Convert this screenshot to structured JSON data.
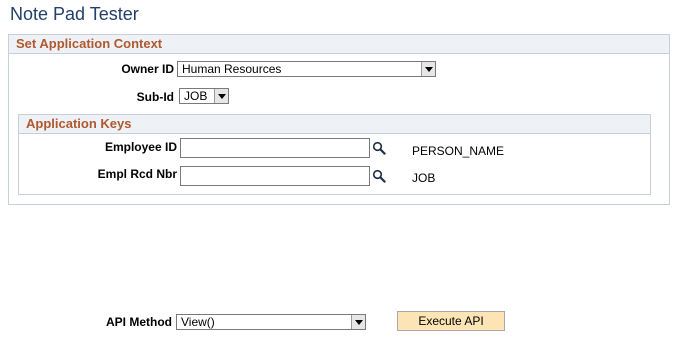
{
  "page": {
    "title": "Note Pad Tester"
  },
  "context": {
    "header": "Set Application Context",
    "owner_id": {
      "label": "Owner ID",
      "value": "Human Resources"
    },
    "sub_id": {
      "label": "Sub-Id",
      "value": "JOB"
    },
    "keys": {
      "header": "Application Keys",
      "employee_id": {
        "label": "Employee ID",
        "value": "",
        "description": "PERSON_NAME"
      },
      "empl_rcd_nbr": {
        "label": "Empl Rcd Nbr",
        "value": "",
        "description": "JOB"
      }
    }
  },
  "api": {
    "label": "API Method",
    "value": "View()",
    "execute_label": "Execute API"
  },
  "icons": {
    "lookup": "magnifier-icon",
    "dropdown": "chevron-down-icon"
  }
}
